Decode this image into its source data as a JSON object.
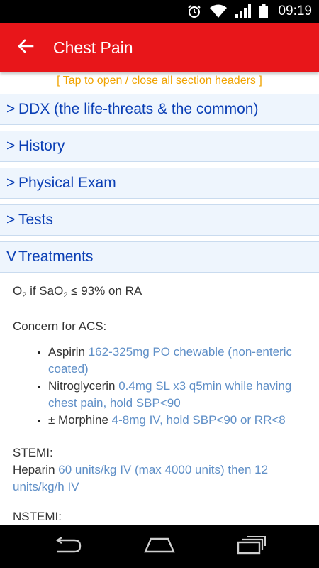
{
  "status_bar": {
    "time": "09:19",
    "icons": [
      "alarm-icon",
      "wifi-icon",
      "signal-icon",
      "battery-icon"
    ]
  },
  "app_bar": {
    "back_icon": "arrow-left-icon",
    "title": "Chest Pain",
    "color": "#e8161a"
  },
  "hint": "[ Tap to open / close all section headers ]",
  "sections": [
    {
      "chevron": ">",
      "label": "DDX (the life-threats & the common)"
    },
    {
      "chevron": ">",
      "label": "History"
    },
    {
      "chevron": ">",
      "label": "Physical Exam"
    },
    {
      "chevron": ">",
      "label": "Tests"
    },
    {
      "chevron": "V",
      "label": "Treatments"
    }
  ],
  "treatments": {
    "o2_line": {
      "prefix": "O",
      "sub1": "2",
      "mid": " if SaO",
      "sub2": "2",
      "suffix": " ≤ 93% on RA"
    },
    "acs_heading": "Concern for ACS:",
    "acs_items": [
      {
        "drug": "Aspirin",
        "dose": "162-325mg PO chewable (non-enteric coated)"
      },
      {
        "drug": "Nitroglycerin",
        "dose": "0.4mg SL x3 q5min while having chest pain, hold SBP<90"
      },
      {
        "drug": "± Morphine",
        "dose": "4-8mg IV, hold SBP<90 or RR<8"
      }
    ],
    "stemi_heading": "STEMI:",
    "stemi_drug": "Heparin",
    "stemi_dose": "60 units/kg IV (max 4000 units) then 12 units/kg/h IV",
    "nstemi_heading": "NSTEMI:"
  },
  "nav_bar": {
    "icons": [
      "back-nav-icon",
      "home-nav-icon",
      "recents-nav-icon"
    ]
  },
  "colors": {
    "accent_red": "#e8161a",
    "section_text": "#0b3fb5",
    "dose_text": "#5f8fc7",
    "hint_text": "#f0a300"
  }
}
